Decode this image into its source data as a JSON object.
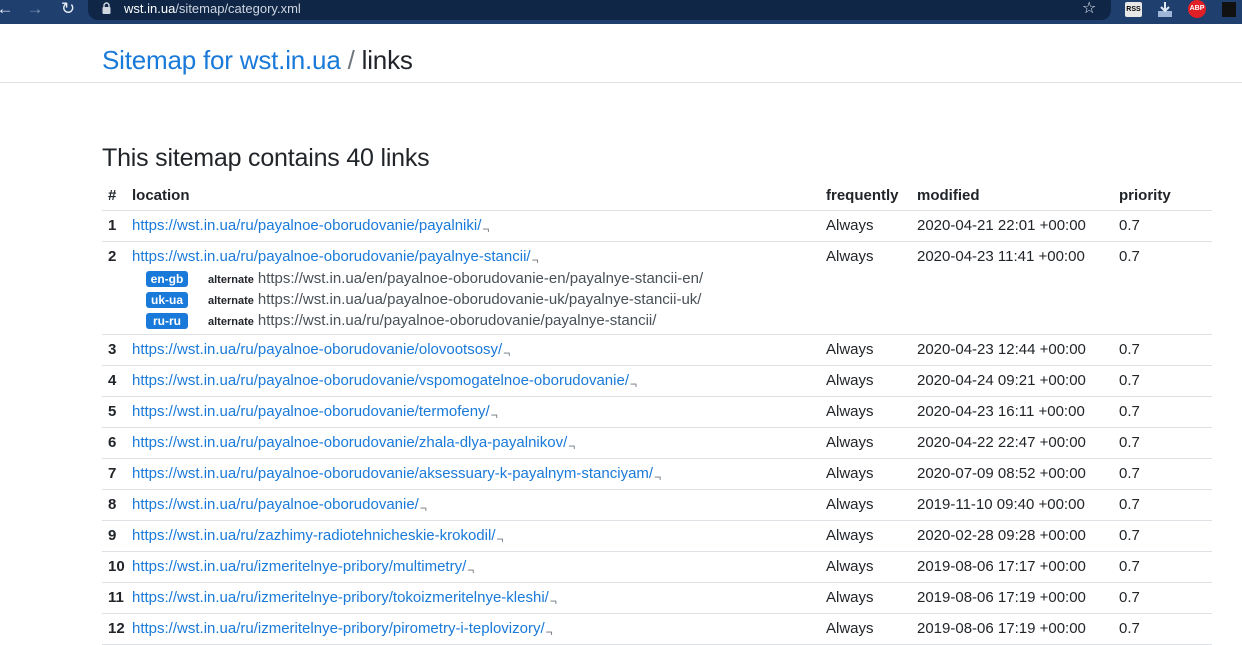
{
  "browser": {
    "url_host": "wst.in.ua",
    "url_path": "/sitemap/category.xml",
    "ext_abp": "ABP",
    "ext_rss": "RSS"
  },
  "page": {
    "title_link": "Sitemap for wst.in.ua",
    "title_separator": " / ",
    "title_section": "links",
    "summary": "This sitemap contains 40 links"
  },
  "table": {
    "headers": {
      "num": "#",
      "location": "location",
      "frequently": "frequently",
      "modified": "modified",
      "priority": "priority"
    },
    "alternate_label": "alternate",
    "rows": [
      {
        "num": "1",
        "location": "https://wst.in.ua/ru/payalnoe-oborudovanie/payalniki/",
        "frequently": "Always",
        "modified": "2020-04-21 22:01 +00:00",
        "priority": "0.7"
      },
      {
        "num": "2",
        "location": "https://wst.in.ua/ru/payalnoe-oborudovanie/payalnye-stancii/",
        "frequently": "Always",
        "modified": "2020-04-23 11:41 +00:00",
        "priority": "0.7",
        "alternates": [
          {
            "lang": "en-gb",
            "url": "https://wst.in.ua/en/payalnoe-oborudovanie-en/payalnye-stancii-en/"
          },
          {
            "lang": "uk-ua",
            "url": "https://wst.in.ua/ua/payalnoe-oborudovanie-uk/payalnye-stancii-uk/"
          },
          {
            "lang": "ru-ru",
            "url": "https://wst.in.ua/ru/payalnoe-oborudovanie/payalnye-stancii/"
          }
        ]
      },
      {
        "num": "3",
        "location": "https://wst.in.ua/ru/payalnoe-oborudovanie/olovootsosy/",
        "frequently": "Always",
        "modified": "2020-04-23 12:44 +00:00",
        "priority": "0.7"
      },
      {
        "num": "4",
        "location": "https://wst.in.ua/ru/payalnoe-oborudovanie/vspomogatelnoe-oborudovanie/",
        "frequently": "Always",
        "modified": "2020-04-24 09:21 +00:00",
        "priority": "0.7"
      },
      {
        "num": "5",
        "location": "https://wst.in.ua/ru/payalnoe-oborudovanie/termofeny/",
        "frequently": "Always",
        "modified": "2020-04-23 16:11 +00:00",
        "priority": "0.7"
      },
      {
        "num": "6",
        "location": "https://wst.in.ua/ru/payalnoe-oborudovanie/zhala-dlya-payalnikov/",
        "frequently": "Always",
        "modified": "2020-04-22 22:47 +00:00",
        "priority": "0.7"
      },
      {
        "num": "7",
        "location": "https://wst.in.ua/ru/payalnoe-oborudovanie/aksessuary-k-payalnym-stanciyam/",
        "frequently": "Always",
        "modified": "2020-07-09 08:52 +00:00",
        "priority": "0.7"
      },
      {
        "num": "8",
        "location": "https://wst.in.ua/ru/payalnoe-oborudovanie/",
        "frequently": "Always",
        "modified": "2019-11-10 09:40 +00:00",
        "priority": "0.7"
      },
      {
        "num": "9",
        "location": "https://wst.in.ua/ru/zazhimy-radiotehnicheskie-krokodil/",
        "frequently": "Always",
        "modified": "2020-02-28 09:28 +00:00",
        "priority": "0.7"
      },
      {
        "num": "10",
        "location": "https://wst.in.ua/ru/izmeritelnye-pribory/multimetry/",
        "frequently": "Always",
        "modified": "2019-08-06 17:17 +00:00",
        "priority": "0.7"
      },
      {
        "num": "11",
        "location": "https://wst.in.ua/ru/izmeritelnye-pribory/tokoizmeritelnye-kleshi/",
        "frequently": "Always",
        "modified": "2019-08-06 17:19 +00:00",
        "priority": "0.7"
      },
      {
        "num": "12",
        "location": "https://wst.in.ua/ru/izmeritelnye-pribory/pirometry-i-teplovizory/",
        "frequently": "Always",
        "modified": "2019-08-06 17:19 +00:00",
        "priority": "0.7"
      }
    ]
  }
}
